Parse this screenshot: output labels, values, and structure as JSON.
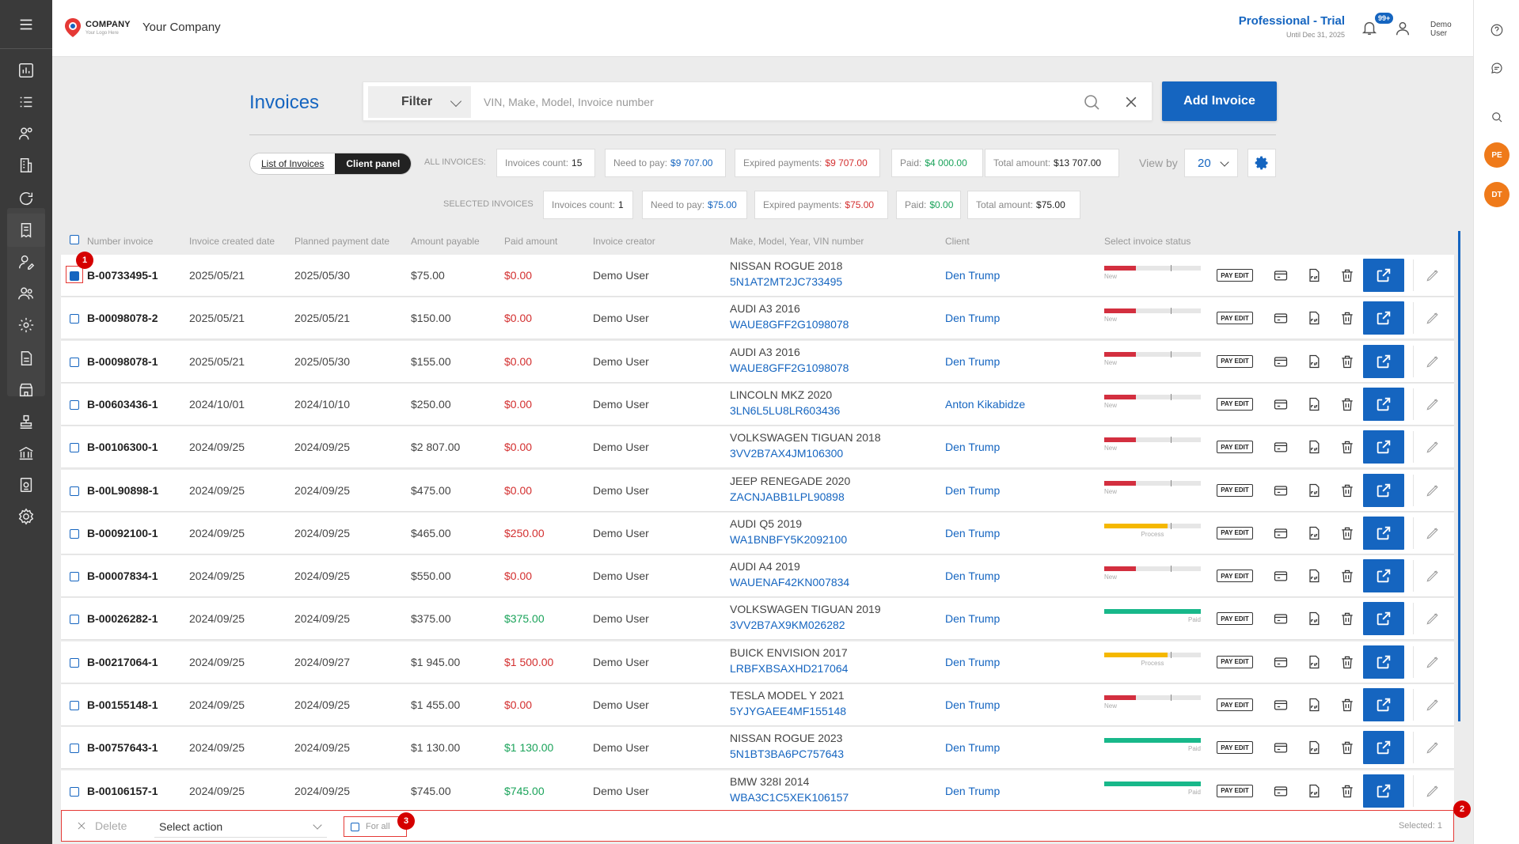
{
  "header": {
    "logo_company": "COMPANY",
    "logo_tagline": "Your Logo Here",
    "company_name": "Your Company",
    "plan_title": "Professional - Trial",
    "plan_until": "Until Dec 31, 2025",
    "notifications_badge": "99+",
    "user_name_line1": "Demo",
    "user_name_line2": "User"
  },
  "rail": {
    "avatar_1": "PE",
    "avatar_2": "DT"
  },
  "page": {
    "title": "Invoices",
    "filter_label": "Filter",
    "search_placeholder": "VIN, Make, Model, Invoice number",
    "add_invoice_label": "Add Invoice"
  },
  "toggle": {
    "list_label": "List of Invoices",
    "client_label": "Client panel"
  },
  "all_invoices": {
    "label": "ALL INVOICES:",
    "count_label": "Invoices count:",
    "count_value": "15",
    "need_label": "Need to pay:",
    "need_value": "$9 707.00",
    "expired_label": "Expired payments:",
    "expired_value": "$9 707.00",
    "paid_label": "Paid:",
    "paid_value": "$4 000.00",
    "total_label": "Total amount:",
    "total_value": "$13 707.00"
  },
  "selected_invoices": {
    "label": "SELECTED INVOICES",
    "count_label": "Invoices count:",
    "count_value": "1",
    "need_label": "Need to pay:",
    "need_value": "$75.00",
    "expired_label": "Expired payments:",
    "expired_value": "$75.00",
    "paid_label": "Paid:",
    "paid_value": "$0.00",
    "total_label": "Total amount:",
    "total_value": "$75.00"
  },
  "view_by": {
    "label": "View by",
    "value": "20"
  },
  "table": {
    "headers": {
      "number": "Number invoice",
      "created": "Invoice created date",
      "planned": "Planned payment date",
      "amount": "Amount payable",
      "paid": "Paid amount",
      "creator": "Invoice creator",
      "vehicle": "Make, Model, Year, VIN number",
      "client": "Client",
      "status": "Select invoice status"
    },
    "pay_edit_label": "PAY EDIT",
    "rows": [
      {
        "num": "B-00733495-1",
        "created": "2025/05/21",
        "planned": "2025/05/30",
        "amount": "$75.00",
        "paid": "$0.00",
        "paid_color": "red",
        "creator": "Demo User",
        "car": "NISSAN ROGUE 2018",
        "vin": "5N1AT2MT2JC733495",
        "client": "Den Trump",
        "status": "New",
        "status_level": 0.33,
        "checked": true
      },
      {
        "num": "B-00098078-2",
        "created": "2025/05/21",
        "planned": "2025/05/21",
        "amount": "$150.00",
        "paid": "$0.00",
        "paid_color": "red",
        "creator": "Demo User",
        "car": "AUDI A3 2016",
        "vin": "WAUE8GFF2G1098078",
        "client": "Den Trump",
        "status": "New",
        "status_level": 0.33,
        "checked": false
      },
      {
        "num": "B-00098078-1",
        "created": "2025/05/21",
        "planned": "2025/05/30",
        "amount": "$155.00",
        "paid": "$0.00",
        "paid_color": "red",
        "creator": "Demo User",
        "car": "AUDI A3 2016",
        "vin": "WAUE8GFF2G1098078",
        "client": "Den Trump",
        "status": "New",
        "status_level": 0.33,
        "checked": false
      },
      {
        "num": "B-00603436-1",
        "created": "2024/10/01",
        "planned": "2024/10/10",
        "amount": "$250.00",
        "paid": "$0.00",
        "paid_color": "red",
        "creator": "Demo User",
        "car": "LINCOLN MKZ 2020",
        "vin": "3LN6L5LU8LR603436",
        "client": "Anton Kikabidze",
        "status": "New",
        "status_level": 0.33,
        "checked": false
      },
      {
        "num": "B-00106300-1",
        "created": "2024/09/25",
        "planned": "2024/09/25",
        "amount": "$2 807.00",
        "paid": "$0.00",
        "paid_color": "red",
        "creator": "Demo User",
        "car": "VOLKSWAGEN TIGUAN 2018",
        "vin": "3VV2B7AX4JM106300",
        "client": "Den Trump",
        "status": "New",
        "status_level": 0.33,
        "checked": false
      },
      {
        "num": "B-00L90898-1",
        "created": "2024/09/25",
        "planned": "2024/09/25",
        "amount": "$475.00",
        "paid": "$0.00",
        "paid_color": "red",
        "creator": "Demo User",
        "car": "JEEP RENEGADE 2020",
        "vin": "ZACNJABB1LPL90898",
        "client": "Den Trump",
        "status": "New",
        "status_level": 0.33,
        "checked": false
      },
      {
        "num": "B-00092100-1",
        "created": "2024/09/25",
        "planned": "2024/09/25",
        "amount": "$465.00",
        "paid": "$250.00",
        "paid_color": "red",
        "creator": "Demo User",
        "car": "AUDI Q5 2019",
        "vin": "WA1BNBFY5K2092100",
        "client": "Den Trump",
        "status": "Process",
        "status_level": 0.67,
        "checked": false
      },
      {
        "num": "B-00007834-1",
        "created": "2024/09/25",
        "planned": "2024/09/25",
        "amount": "$550.00",
        "paid": "$0.00",
        "paid_color": "red",
        "creator": "Demo User",
        "car": "AUDI A4 2019",
        "vin": "WAUENAF42KN007834",
        "client": "Den Trump",
        "status": "New",
        "status_level": 0.33,
        "checked": false
      },
      {
        "num": "B-00026282-1",
        "created": "2024/09/25",
        "planned": "2024/09/25",
        "amount": "$375.00",
        "paid": "$375.00",
        "paid_color": "green",
        "creator": "Demo User",
        "car": "VOLKSWAGEN TIGUAN 2019",
        "vin": "3VV2B7AX9KM026282",
        "client": "Den Trump",
        "status": "Paid",
        "status_level": 1.0,
        "checked": false
      },
      {
        "num": "B-00217064-1",
        "created": "2024/09/25",
        "planned": "2024/09/27",
        "amount": "$1 945.00",
        "paid": "$1 500.00",
        "paid_color": "red",
        "creator": "Demo User",
        "car": "BUICK ENVISION 2017",
        "vin": "LRBFXBSAXHD217064",
        "client": "Den Trump",
        "status": "Process",
        "status_level": 0.67,
        "checked": false
      },
      {
        "num": "B-00155148-1",
        "created": "2024/09/25",
        "planned": "2024/09/25",
        "amount": "$1 455.00",
        "paid": "$0.00",
        "paid_color": "red",
        "creator": "Demo User",
        "car": "TESLA MODEL Y 2021",
        "vin": "5YJYGAEE4MF155148",
        "client": "Den Trump",
        "status": "New",
        "status_level": 0.33,
        "checked": false
      },
      {
        "num": "B-00757643-1",
        "created": "2024/09/25",
        "planned": "2024/09/25",
        "amount": "$1 130.00",
        "paid": "$1 130.00",
        "paid_color": "green",
        "creator": "Demo User",
        "car": "NISSAN ROGUE 2023",
        "vin": "5N1BT3BA6PC757643",
        "client": "Den Trump",
        "status": "Paid",
        "status_level": 1.0,
        "checked": false
      },
      {
        "num": "B-00106157-1",
        "created": "2024/09/25",
        "planned": "2024/09/25",
        "amount": "$745.00",
        "paid": "$745.00",
        "paid_color": "green",
        "creator": "Demo User",
        "car": "BMW 328I 2014",
        "vin": "WBA3C1C5XEK106157",
        "client": "Den Trump",
        "status": "Paid",
        "status_level": 1.0,
        "checked": false
      }
    ]
  },
  "action_bar": {
    "delete_label": "Delete",
    "select_action_label": "Select action",
    "for_all_label": "For all",
    "selected_label": "Selected: 1"
  },
  "markers": {
    "m1": "1",
    "m2": "2",
    "m3": "3"
  },
  "colors": {
    "brand_blue": "#1565c0",
    "red": "#d32f2f",
    "green": "#1aa35a",
    "status_new": "#d32f3f",
    "status_process": "#f5b800",
    "status_paid": "#18b88a"
  }
}
